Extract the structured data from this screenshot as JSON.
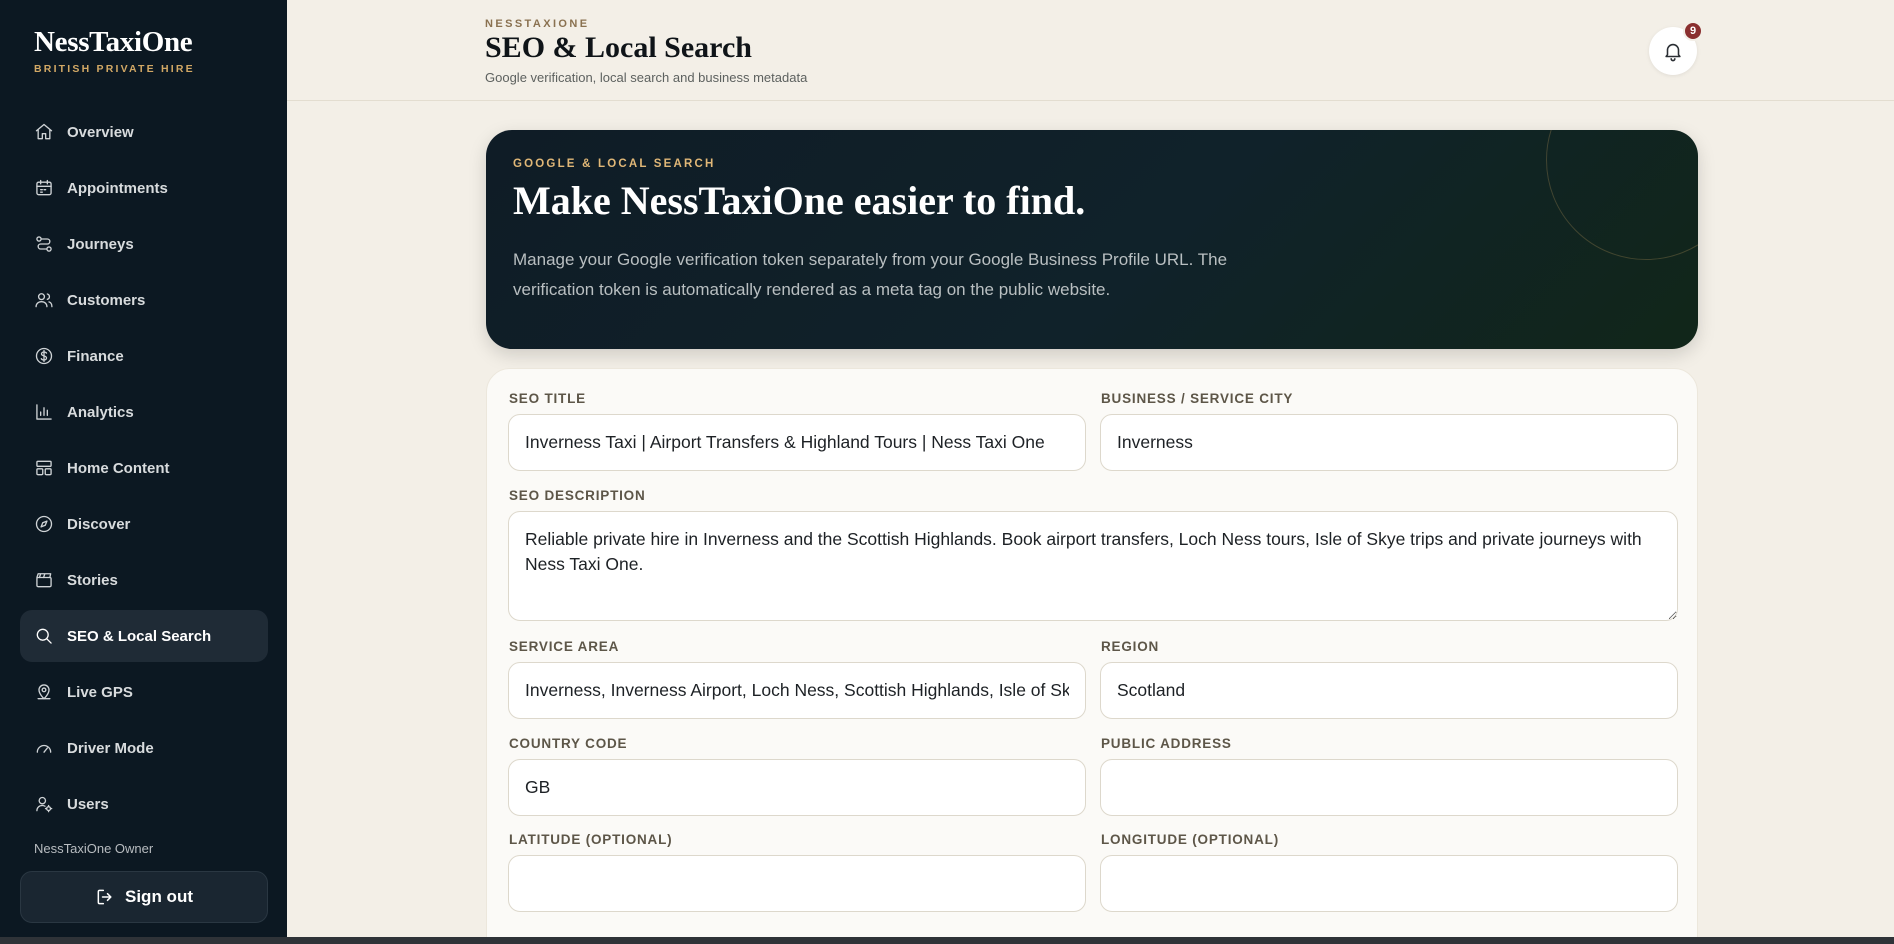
{
  "sidebar": {
    "brand_name": "NessTaxiOne",
    "brand_tagline": "BRITISH PRIVATE HIRE",
    "items": [
      {
        "label": "Overview",
        "icon": "home-icon"
      },
      {
        "label": "Appointments",
        "icon": "calendar-icon"
      },
      {
        "label": "Journeys",
        "icon": "route-icon"
      },
      {
        "label": "Customers",
        "icon": "users-icon"
      },
      {
        "label": "Finance",
        "icon": "dollar-icon"
      },
      {
        "label": "Analytics",
        "icon": "bar-chart-icon"
      },
      {
        "label": "Home Content",
        "icon": "layout-icon"
      },
      {
        "label": "Discover",
        "icon": "compass-icon"
      },
      {
        "label": "Stories",
        "icon": "clapperboard-icon"
      },
      {
        "label": "SEO & Local Search",
        "icon": "search-icon",
        "active": true
      },
      {
        "label": "Live GPS",
        "icon": "map-pin-icon"
      },
      {
        "label": "Driver Mode",
        "icon": "gauge-icon"
      },
      {
        "label": "Users",
        "icon": "user-cog-icon"
      }
    ],
    "owner": "NessTaxiOne Owner",
    "signout_label": "Sign out"
  },
  "header": {
    "eyebrow": "NESSTAXIONE",
    "title": "SEO & Local Search",
    "subtitle": "Google verification, local search and business metadata",
    "notification_count": "9"
  },
  "hero": {
    "eyebrow": "GOOGLE & LOCAL SEARCH",
    "title": "Make NessTaxiOne easier to find.",
    "description": "Manage your Google verification token separately from your Google Business Profile URL. The verification token is automatically rendered as a meta tag on the public website."
  },
  "form": {
    "seo_title": {
      "label": "SEO TITLE",
      "value": "Inverness Taxi | Airport Transfers & Highland Tours | Ness Taxi One"
    },
    "city": {
      "label": "BUSINESS / SERVICE CITY",
      "value": "Inverness"
    },
    "seo_description": {
      "label": "SEO DESCRIPTION",
      "value": "Reliable private hire in Inverness and the Scottish Highlands. Book airport transfers, Loch Ness tours, Isle of Skye trips and private journeys with Ness Taxi One."
    },
    "service_area": {
      "label": "SERVICE AREA",
      "value": "Inverness, Inverness Airport, Loch Ness, Scottish Highlands, Isle of Skye"
    },
    "region": {
      "label": "REGION",
      "value": "Scotland"
    },
    "country_code": {
      "label": "COUNTRY CODE",
      "value": "GB"
    },
    "public_address": {
      "label": "PUBLIC ADDRESS",
      "value": ""
    },
    "latitude": {
      "label": "LATITUDE (OPTIONAL)",
      "value": ""
    },
    "longitude": {
      "label": "LONGITUDE (OPTIONAL)",
      "value": ""
    }
  },
  "colors": {
    "sidebar_bg": "#0c1822",
    "accent_gold": "#d2a865",
    "page_bg": "#f3efe7",
    "badge": "#8a2f2f"
  }
}
